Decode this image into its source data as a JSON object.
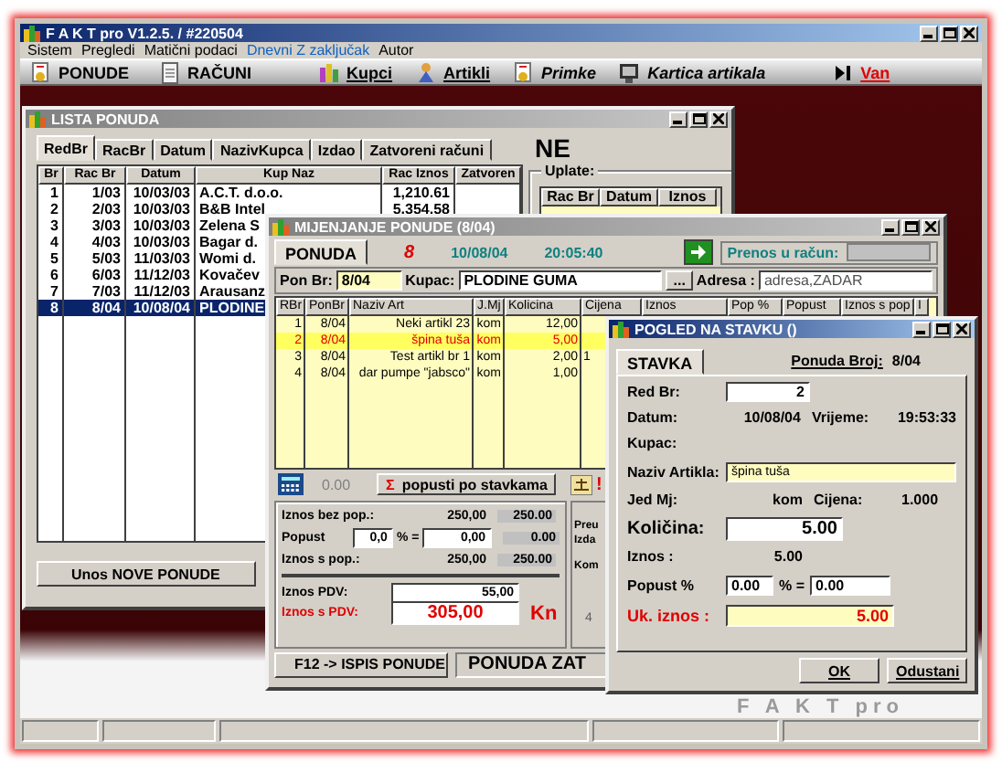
{
  "app": {
    "title": "F A K T pro  V1.2.5. / #220504"
  },
  "menu": [
    {
      "label": "Sistem",
      "kind": "plain"
    },
    {
      "label": "Pregledi",
      "kind": "plain"
    },
    {
      "label": "Matični podaci",
      "kind": "plain"
    },
    {
      "label": "Dnevni Z zaključak",
      "kind": "link"
    },
    {
      "label": "Autor",
      "kind": "plain"
    }
  ],
  "toolbar": [
    {
      "label": "PONUDE",
      "kind": "plain"
    },
    {
      "label": "RAČUNI",
      "kind": "plain"
    },
    {
      "label": "Kupci",
      "kind": "underlined"
    },
    {
      "label": "Artikli",
      "kind": "underlined"
    },
    {
      "label": "Primke",
      "kind": "italic"
    },
    {
      "label": "Kartica artikala",
      "kind": "italic"
    },
    {
      "label": "Van",
      "kind": "exit"
    }
  ],
  "desktop": {
    "logo": "F A K T pro"
  },
  "list_window": {
    "title": "LISTA PONUDA",
    "tabs": [
      {
        "label": "RedBr",
        "selected": true
      },
      {
        "label": "RacBr",
        "selected": false
      },
      {
        "label": "Datum",
        "selected": false
      },
      {
        "label": "NazivKupca",
        "selected": false
      },
      {
        "label": "Izdao",
        "selected": false
      },
      {
        "label": "Zatvoreni računi",
        "selected": false
      }
    ],
    "flag": "NE",
    "columns": [
      "Br",
      "Rac Br",
      "Datum",
      "Kup Naz",
      "Rac Iznos",
      "Zatvoren"
    ],
    "rows": [
      {
        "cells": [
          "1",
          "1/03",
          "10/03/03",
          "A.C.T. d.o.o.",
          "1,210.61"
        ],
        "selected": false
      },
      {
        "cells": [
          "2",
          "2/03",
          "10/03/03",
          "B&B Intel",
          "5,354.58"
        ],
        "selected": false
      },
      {
        "cells": [
          "3",
          "3/03",
          "10/03/03",
          "Zelena S"
        ],
        "selected": false
      },
      {
        "cells": [
          "4",
          "4/03",
          "10/03/03",
          "Bagar d."
        ],
        "selected": false
      },
      {
        "cells": [
          "5",
          "5/03",
          "11/03/03",
          "Womi d."
        ],
        "selected": false
      },
      {
        "cells": [
          "6",
          "6/03",
          "11/12/03",
          "Kovačev"
        ],
        "selected": false
      },
      {
        "cells": [
          "7",
          "7/03",
          "11/12/03",
          "Arausanz"
        ],
        "selected": false
      },
      {
        "cells": [
          "8",
          "8/04",
          "10/08/04",
          "PLODINE"
        ],
        "selected": true
      }
    ],
    "payments": {
      "title": "Uplate:",
      "columns": [
        "Rac Br",
        "Datum",
        "Iznos"
      ]
    },
    "new_button": "Unos NOVE PONUDE"
  },
  "edit_window": {
    "title": "MIJENJANJE PONUDE (8/04)",
    "tab": {
      "label": "PONUDA",
      "selected": true
    },
    "number": "8",
    "date": "10/08/04",
    "time": "20:05:40",
    "transfer": "Prenos u račun:",
    "offer_no": {
      "label": "Pon Br:",
      "value": "8/04"
    },
    "customer": {
      "label": "Kupac:",
      "value": "PLODINE GUMA",
      "button": "..."
    },
    "address": {
      "label": "Adresa :",
      "value": "adresa,ZADAR"
    },
    "columns": [
      "RBr",
      "PonBr",
      "Naziv Art",
      "J.Mj",
      "Kolicina",
      "Cijena",
      "Iznos",
      "Pop %",
      "Popust",
      "Iznos s pop",
      "I"
    ],
    "rows": [
      {
        "cells": [
          "1",
          "8/04",
          "Neki artikl 23",
          "kom",
          "12,00"
        ],
        "selected": false
      },
      {
        "cells": [
          "2",
          "8/04",
          "špina tuša",
          "kom",
          "5,00"
        ],
        "selected": true
      },
      {
        "cells": [
          "3",
          "8/04",
          "Test artikl br 1",
          "kom",
          "2,00",
          "1"
        ],
        "selected": false
      },
      {
        "cells": [
          "4",
          "8/04",
          "dar pumpe \"jabsco\"",
          "kom",
          "1,00"
        ],
        "selected": false
      }
    ],
    "discount_bar": {
      "amount": "0.00",
      "sum_glyph": "Σ",
      "button": "popusti po stavkama"
    },
    "totals": [
      {
        "kind": "pair",
        "label": "Iznos bez pop.:",
        "value": "250,00",
        "base": "250.00"
      },
      {
        "kind": "discount",
        "label": "Popust",
        "percent": "0,0",
        "operator": "% =",
        "value": "0,00",
        "base": "0.00"
      },
      {
        "kind": "pair",
        "label": "Iznos s pop.:",
        "value": "250,00",
        "base": "250.00"
      },
      {
        "kind": "field",
        "label": "Iznos PDV:",
        "value": "55,00"
      },
      {
        "kind": "total",
        "label": "Iznos s PDV:",
        "value": "305,00",
        "currency": "Kn"
      }
    ],
    "side_panel": {
      "alert": "!",
      "labels": [
        "Preu",
        "Izda",
        "Kom"
      ],
      "count": "4"
    },
    "print_button": "F12 -> ISPIS PONUDE",
    "status": "PONUDA ZAT"
  },
  "item_window": {
    "title": "POGLED NA STAVKU ()",
    "tab": {
      "label": "STAVKA",
      "selected": true
    },
    "offer_label": "Ponuda Broj:",
    "offer_value": "8/04",
    "rows": [
      {
        "kind": "field",
        "label": "Red Br:",
        "value": "2"
      },
      {
        "kind": "pair",
        "label": "Datum:",
        "value": "10/08/04",
        "label2": "Vrijeme:",
        "value2": "19:53:33"
      },
      {
        "kind": "label",
        "label": "Kupac:"
      },
      {
        "kind": "wide_field",
        "label": "Naziv Artikla:",
        "value": "špina tuša"
      },
      {
        "kind": "pair",
        "label": "Jed Mj:",
        "value": "kom",
        "label2": "Cijena:",
        "value2": "1.000"
      },
      {
        "kind": "big_field",
        "label": "Količina:",
        "value": "5.00"
      },
      {
        "kind": "text",
        "label": "Iznos :",
        "value": "5.00"
      },
      {
        "kind": "discount",
        "label": "Popust %",
        "value": "0.00",
        "operator": "% =",
        "value2": "0.00"
      },
      {
        "kind": "total",
        "label": "Uk. iznos :",
        "value": "5.00"
      }
    ],
    "buttons": [
      "OK",
      "Odustani"
    ]
  }
}
